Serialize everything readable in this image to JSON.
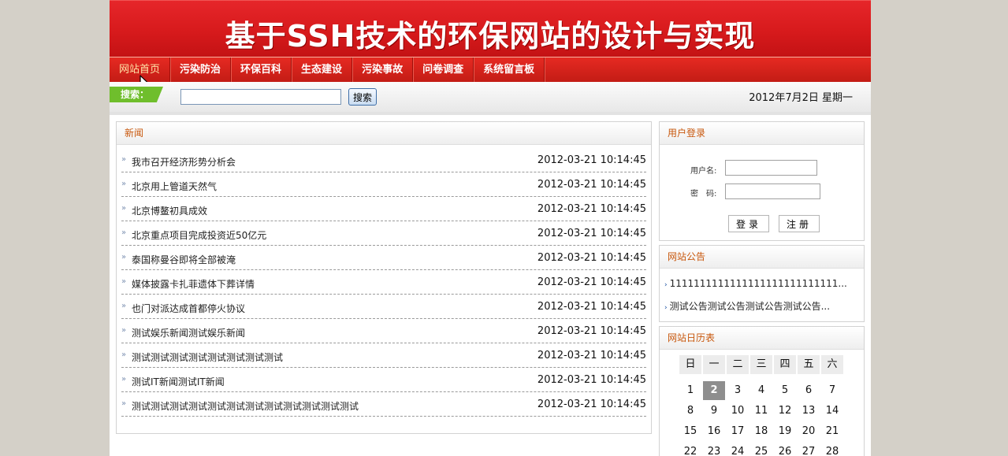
{
  "banner": {
    "title": "基于SSH技术的环保网站的设计与实现"
  },
  "nav": {
    "items": [
      {
        "label": "网站首页"
      },
      {
        "label": "污染防治"
      },
      {
        "label": "环保百科"
      },
      {
        "label": "生态建设"
      },
      {
        "label": "污染事故"
      },
      {
        "label": "问卷调查"
      },
      {
        "label": "系统留言板"
      }
    ]
  },
  "search": {
    "label": "搜索：",
    "input_value": "",
    "button": "搜索"
  },
  "date": "2012年7月2日 星期一",
  "news": {
    "title": "新闻",
    "bullet": "»",
    "items": [
      {
        "title": "我市召开经济形势分析会",
        "time": "2012-03-21 10:14:45"
      },
      {
        "title": "北京用上管道天然气",
        "time": "2012-03-21 10:14:45"
      },
      {
        "title": "北京博鳌初具成效",
        "time": "2012-03-21 10:14:45"
      },
      {
        "title": "北京重点项目完成投资近50亿元",
        "time": "2012-03-21 10:14:45"
      },
      {
        "title": "泰国称曼谷即将全部被淹",
        "time": "2012-03-21 10:14:45"
      },
      {
        "title": "媒体披露卡扎菲遗体下葬详情",
        "time": "2012-03-21 10:14:45"
      },
      {
        "title": "也门对派达成首都停火协议",
        "time": "2012-03-21 10:14:45"
      },
      {
        "title": "测试娱乐新闻测试娱乐新闻",
        "time": "2012-03-21 10:14:45"
      },
      {
        "title": "测试测试测试测试测试测试测试测试",
        "time": "2012-03-21 10:14:45"
      },
      {
        "title": "测试IT新闻测试IT新闻",
        "time": "2012-03-21 10:14:45"
      },
      {
        "title": "测试测试测试测试测试测试测试测试测试测试测试测试",
        "time": "2012-03-21 10:14:45"
      }
    ]
  },
  "login": {
    "title": "用户登录",
    "username_label": "用户名:",
    "password_label": "密　码:",
    "login_button": "登录",
    "register_button": "注册"
  },
  "notice": {
    "title": "网站公告",
    "bullet": "›",
    "items": [
      {
        "text": "1111111111111111111111111111..."
      },
      {
        "text": "测试公告测试公告测试公告测试公告..."
      }
    ]
  },
  "calendar": {
    "title": "网站日历表",
    "weekdays": [
      "日",
      "一",
      "二",
      "三",
      "四",
      "五",
      "六"
    ],
    "today": 2,
    "rows": [
      [
        "1",
        "2",
        "3",
        "4",
        "5",
        "6",
        "7"
      ],
      [
        "8",
        "9",
        "10",
        "11",
        "12",
        "13",
        "14"
      ],
      [
        "15",
        "16",
        "17",
        "18",
        "19",
        "20",
        "21"
      ],
      [
        "22",
        "23",
        "24",
        "25",
        "26",
        "27",
        "28"
      ]
    ]
  },
  "colors": {
    "banner_red": "#d71a1c",
    "nav_red": "#c31c15",
    "search_green": "#6fbe2c",
    "panel_title": "#c8570c"
  }
}
